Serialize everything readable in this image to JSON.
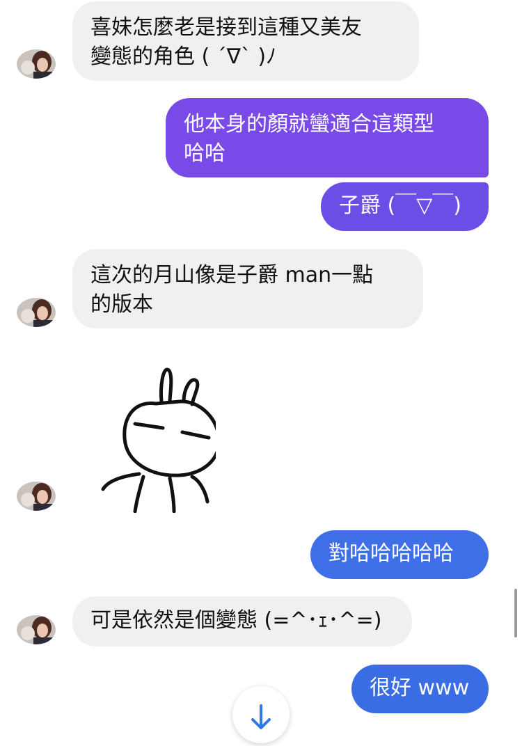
{
  "messages": [
    {
      "sender": "other",
      "text": "喜妹怎麼老是接到這種又美友\n變態的角色 ( ´∇` )ﾉ"
    },
    {
      "sender": "me",
      "text": "他本身的顏就蠻適合這類型\n哈哈",
      "color": "#7a4ae8"
    },
    {
      "sender": "me",
      "text": "子爵 (￣▽￣)",
      "color": "#6a4ee6"
    },
    {
      "sender": "other",
      "text": "這次的月山像是子爵 man一點\n的版本"
    },
    {
      "sender": "other",
      "type": "sticker",
      "sticker": "rabbit-sticker"
    },
    {
      "sender": "me",
      "text": "對哈哈哈哈哈",
      "color": "#3f6fe6"
    },
    {
      "sender": "other",
      "text": "可是依然是個變態 (=^･ｪ･^=)"
    },
    {
      "sender": "me",
      "text": "很好 www",
      "color": "#3a6de4"
    }
  ],
  "icons": {
    "avatar": "user-avatar-photo",
    "scroll_down": "arrow-down-icon"
  },
  "colors": {
    "incoming_bubble": "#f0f0f0",
    "accent_blue": "#2f7ae5"
  }
}
